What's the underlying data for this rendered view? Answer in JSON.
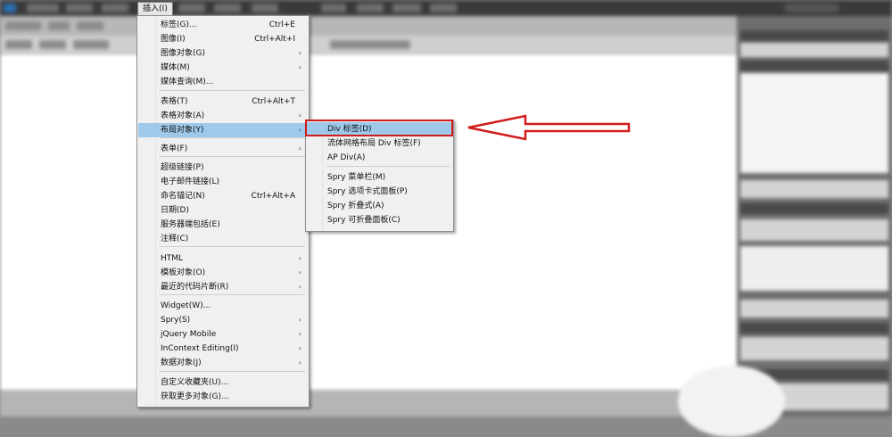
{
  "menu_bar": {
    "active_menu_label": "插入(I)"
  },
  "insert_menu": {
    "items": [
      {
        "label": "标签(G)...",
        "shortcut": "Ctrl+E",
        "submenu": false
      },
      {
        "label": "图像(I)",
        "shortcut": "Ctrl+Alt+I",
        "submenu": false
      },
      {
        "label": "图像对象(G)",
        "shortcut": "",
        "submenu": true
      },
      {
        "label": "媒体(M)",
        "shortcut": "",
        "submenu": true
      },
      {
        "label": "媒体查询(M)...",
        "shortcut": "",
        "submenu": false
      },
      {
        "label": "表格(T)",
        "shortcut": "Ctrl+Alt+T",
        "submenu": false
      },
      {
        "label": "表格对象(A)",
        "shortcut": "",
        "submenu": true
      },
      {
        "label": "布局对象(Y)",
        "shortcut": "",
        "submenu": true
      },
      {
        "label": "表单(F)",
        "shortcut": "",
        "submenu": true
      },
      {
        "label": "超级链接(P)",
        "shortcut": "",
        "submenu": false
      },
      {
        "label": "电子邮件链接(L)",
        "shortcut": "",
        "submenu": false
      },
      {
        "label": "命名锚记(N)",
        "shortcut": "Ctrl+Alt+A",
        "submenu": false
      },
      {
        "label": "日期(D)",
        "shortcut": "",
        "submenu": false
      },
      {
        "label": "服务器端包括(E)",
        "shortcut": "",
        "submenu": false
      },
      {
        "label": "注释(C)",
        "shortcut": "",
        "submenu": false
      },
      {
        "label": "HTML",
        "shortcut": "",
        "submenu": true
      },
      {
        "label": "模板对象(O)",
        "shortcut": "",
        "submenu": true
      },
      {
        "label": "最近的代码片断(R)",
        "shortcut": "",
        "submenu": true
      },
      {
        "label": "Widget(W)...",
        "shortcut": "",
        "submenu": false
      },
      {
        "label": "Spry(S)",
        "shortcut": "",
        "submenu": true
      },
      {
        "label": "jQuery Mobile",
        "shortcut": "",
        "submenu": true
      },
      {
        "label": "InContext Editing(I)",
        "shortcut": "",
        "submenu": true
      },
      {
        "label": "数据对象(J)",
        "shortcut": "",
        "submenu": true
      },
      {
        "label": "自定义收藏夹(U)...",
        "shortcut": "",
        "submenu": false
      },
      {
        "label": "获取更多对象(G)...",
        "shortcut": "",
        "submenu": false
      }
    ],
    "highlighted_index": 7
  },
  "layout_submenu": {
    "items": [
      {
        "label": "Div 标签(D)"
      },
      {
        "label": "流体网格布局 Div 标签(F)"
      },
      {
        "label": "AP Div(A)"
      },
      {
        "label": "Spry 菜单栏(M)"
      },
      {
        "label": "Spry 选项卡式面板(P)"
      },
      {
        "label": "Spry 折叠式(A)"
      },
      {
        "label": "Spry 可折叠面板(C)"
      }
    ],
    "highlighted_index": 0
  },
  "colors": {
    "highlight": "#9fc9ea",
    "annotation": "#d21b1b",
    "menu_bg": "#f0f0f0"
  },
  "icons": {
    "submenu_arrow": "chevron-right-icon"
  }
}
